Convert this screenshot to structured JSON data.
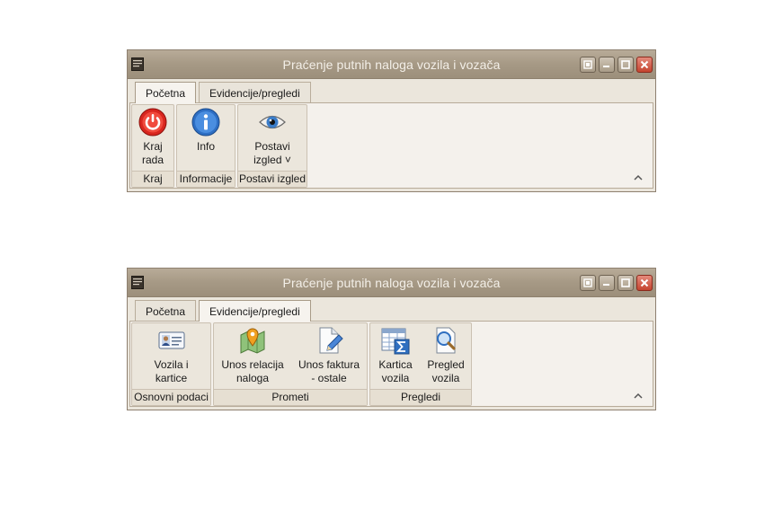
{
  "window_top": {
    "title": "Praćenje putnih naloga vozila i vozača",
    "tabs": [
      "Početna",
      "Evidencije/pregledi"
    ],
    "active_tab": "Početna",
    "groups": [
      {
        "label": "Kraj",
        "buttons": [
          {
            "line1": "Kraj",
            "line2": "rada",
            "icon": "power-icon"
          }
        ]
      },
      {
        "label": "Informacije",
        "buttons": [
          {
            "line1": "Info",
            "line2": "",
            "icon": "info-icon"
          }
        ]
      },
      {
        "label": "Postavi izgled",
        "buttons": [
          {
            "line1": "Postavi",
            "line2": "izgled ˅",
            "icon": "eye-icon"
          }
        ]
      }
    ]
  },
  "window_bottom": {
    "title": "Praćenje putnih naloga vozila i vozača",
    "tabs": [
      "Početna",
      "Evidencije/pregledi"
    ],
    "active_tab": "Evidencije/pregledi",
    "groups": [
      {
        "label": "Osnovni podaci",
        "buttons": [
          {
            "line1": "Vozila i",
            "line2": "kartice",
            "icon": "id-card-icon"
          }
        ]
      },
      {
        "label": "Prometi",
        "buttons": [
          {
            "line1": "Unos relacija",
            "line2": "naloga",
            "icon": "map-pin-icon"
          },
          {
            "line1": "Unos faktura",
            "line2": "- ostale",
            "icon": "document-edit-icon"
          }
        ]
      },
      {
        "label": "Pregledi",
        "buttons": [
          {
            "line1": "Kartica",
            "line2": "vozila",
            "icon": "table-sum-icon"
          },
          {
            "line1": "Pregled",
            "line2": "vozila",
            "icon": "magnifier-document-icon"
          }
        ]
      }
    ]
  },
  "colors": {
    "titlebar": "#a69985",
    "ribbon_bg": "#f4f1ec",
    "group_bg": "#ebe6dc",
    "close_button": "#c5442f"
  }
}
